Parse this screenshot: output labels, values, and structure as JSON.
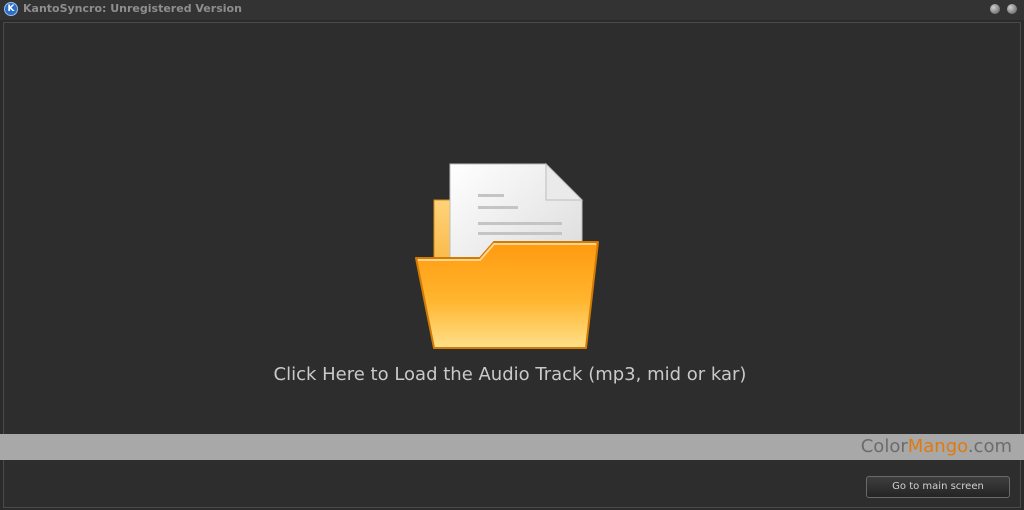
{
  "window": {
    "title": "KantoSyncro: Unregistered Version",
    "logo_letter": "K"
  },
  "titlebar_buttons": {
    "minimize_glyph": "–",
    "close_glyph": "×"
  },
  "load_area": {
    "icon": "folder-open-document-icon",
    "label": "Click Here to Load the Audio Track (mp3, mid or kar)"
  },
  "watermark": {
    "part1": "Color",
    "part2": "Mango",
    "part3": ".com"
  },
  "footer": {
    "main_screen_button": "Go to main screen"
  },
  "colors": {
    "background": "#2b2b2b",
    "folder_orange": "#f39a1a",
    "watermark_accent": "#e07a10"
  }
}
